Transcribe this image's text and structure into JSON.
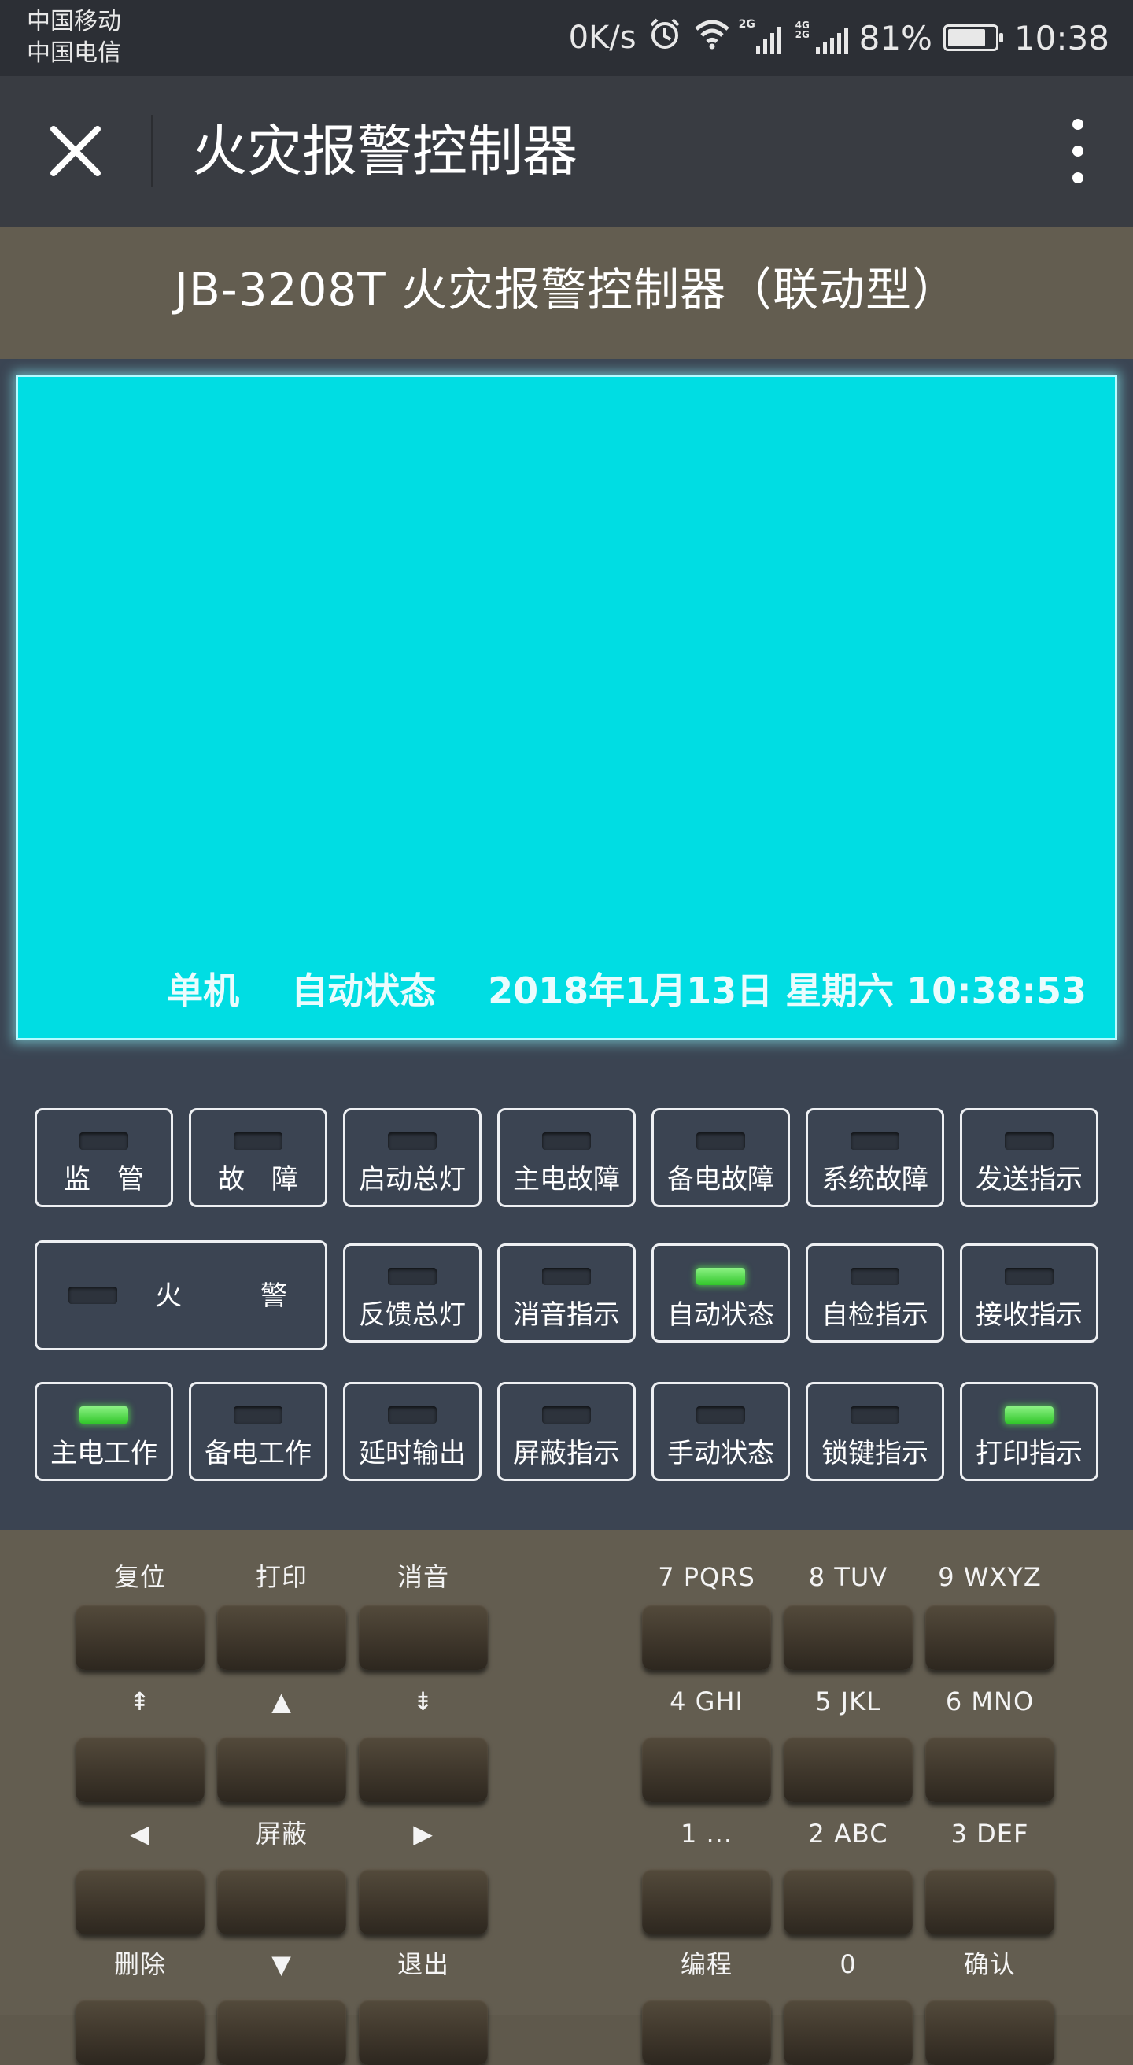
{
  "status_bar": {
    "carrier_1": "中国移动",
    "carrier_2": "中国电信",
    "net_speed": "0K/s",
    "signal_1_tag": "2G",
    "signal_2_tag": "4G\n2G",
    "battery": "81%",
    "battery_level": 0.81,
    "time": "10:38",
    "icons": [
      "alarm-icon",
      "wifi-icon",
      "signal-icon",
      "battery-icon"
    ]
  },
  "app_bar": {
    "title": "火灾报警控制器",
    "close_icon": "close-icon",
    "more_icon": "more-vertical-icon"
  },
  "device": {
    "title": "JB-3208T 火灾报警控制器（联动型）"
  },
  "lcd": {
    "mode": "单机",
    "state": "自动状态",
    "datetime": "2018年1月13日 星期六 10:38:53"
  },
  "indicators": {
    "row1": [
      {
        "label": "监　管",
        "on": false
      },
      {
        "label": "故　障",
        "on": false
      },
      {
        "label": "启动总灯",
        "on": false
      },
      {
        "label": "主电故障",
        "on": false
      },
      {
        "label": "备电故障",
        "on": false
      },
      {
        "label": "系统故障",
        "on": false
      },
      {
        "label": "发送指示",
        "on": false
      }
    ],
    "fire": {
      "label_a": "火",
      "label_b": "警",
      "on": false
    },
    "row2": [
      {
        "label": "反馈总灯",
        "on": false
      },
      {
        "label": "消音指示",
        "on": false
      },
      {
        "label": "自动状态",
        "on": true
      },
      {
        "label": "自检指示",
        "on": false
      },
      {
        "label": "接收指示",
        "on": false
      }
    ],
    "row3": [
      {
        "label": "主电工作",
        "on": true
      },
      {
        "label": "备电工作",
        "on": false
      },
      {
        "label": "延时输出",
        "on": false
      },
      {
        "label": "屏蔽指示",
        "on": false
      },
      {
        "label": "手动状态",
        "on": false
      },
      {
        "label": "锁键指示",
        "on": false
      },
      {
        "label": "打印指示",
        "on": true
      }
    ]
  },
  "keypad": {
    "left": [
      [
        "复位",
        "打印",
        "消音"
      ],
      [
        "⇞",
        "▲",
        "⇟"
      ],
      [
        "◀",
        "屏蔽",
        "▶"
      ],
      [
        "删除",
        "▼",
        "退出"
      ]
    ],
    "right": [
      [
        "7 PQRS",
        "8 TUV",
        "9 WXYZ"
      ],
      [
        "4 GHI",
        "5 JKL",
        "6 MNO"
      ],
      [
        "1 ...",
        "2 ABC",
        "3 DEF"
      ],
      [
        "编程",
        "0",
        "确认"
      ]
    ]
  },
  "colors": {
    "lcd": "#00dde3",
    "panel": "#3b4452",
    "device_bg": "#635d50",
    "led_on": "#3ed636"
  }
}
